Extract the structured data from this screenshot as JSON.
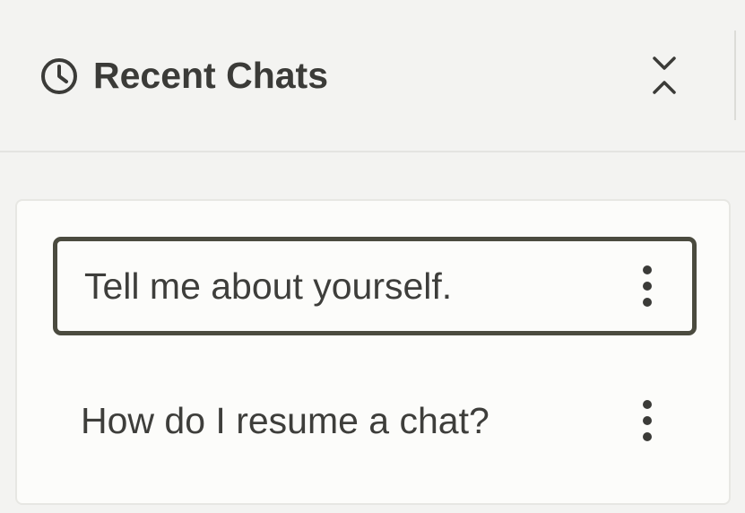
{
  "header": {
    "title": "Recent Chats",
    "icon": "clock-icon",
    "collapse_icon": "collapse-chevrons-icon"
  },
  "chats": [
    {
      "label": "Tell me about yourself.",
      "selected": true,
      "menu_icon": "more-vertical-icon"
    },
    {
      "label": "How do I resume a chat?",
      "selected": false,
      "menu_icon": "more-vertical-icon"
    }
  ],
  "colors": {
    "background": "#f3f3f1",
    "card": "#fcfcfa",
    "text": "#3b3b38",
    "selected_border": "#4b4b3f"
  }
}
